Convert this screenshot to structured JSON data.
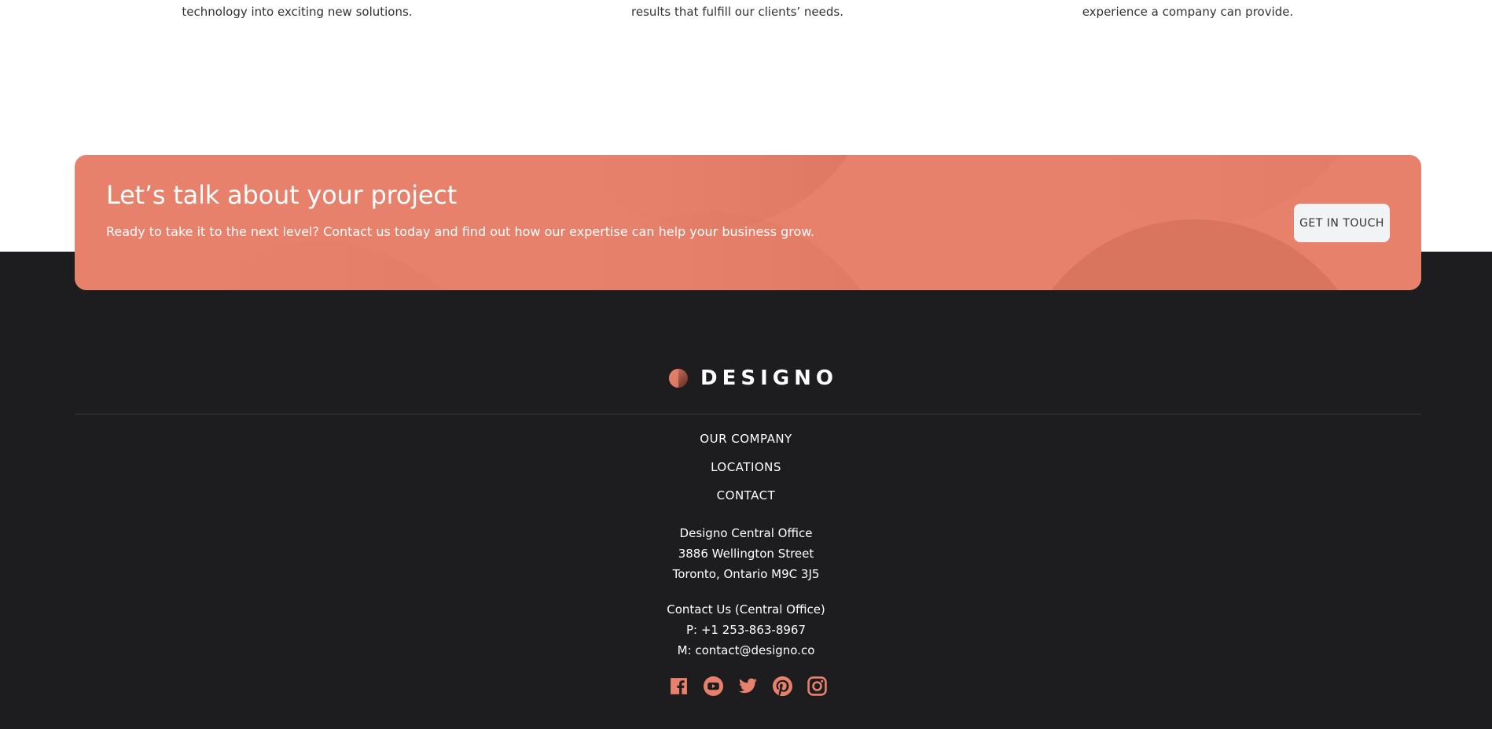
{
  "features": [
    {
      "text_tail": "technology into exciting new solutions."
    },
    {
      "text_tail": "results that fulfill our clients’ needs."
    },
    {
      "text_tail": "experience a company can provide."
    }
  ],
  "cta": {
    "title": "Let’s talk about your project",
    "text": "Ready to take it to the next level? Contact us today and find out how our expertise can help your business grow.",
    "button_label": "GET IN TOUCH"
  },
  "footer": {
    "brand": "DESIGNO",
    "nav": [
      "OUR COMPANY",
      "LOCATIONS",
      "CONTACT"
    ],
    "address": [
      "Designo Central Office",
      "3886 Wellington Street",
      "Toronto, Ontario M9C 3J5"
    ],
    "contact": [
      "Contact Us (Central Office)",
      "P: +1 253-863-8967",
      "M: contact@designo.co"
    ],
    "social_icons": [
      "facebook-icon",
      "youtube-icon",
      "twitter-icon",
      "pinterest-icon",
      "instagram-icon"
    ]
  },
  "colors": {
    "accent": "#e7816b",
    "dark": "#1d1c1e",
    "text_dark": "#333136"
  }
}
